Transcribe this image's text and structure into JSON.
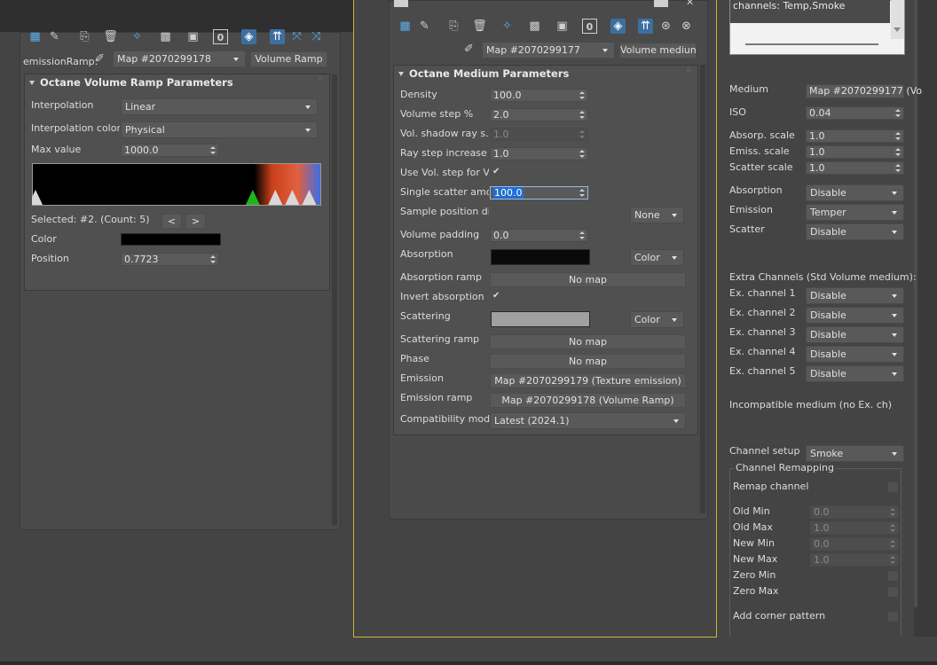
{
  "colors": {
    "background": "#444444",
    "panel": "#505050",
    "accent_yellow": "#c8b438",
    "selection_blue": "#1e6ed0"
  },
  "left_window": {
    "toolbar_icons": [
      "checker-icon",
      "brush-icon",
      "gap",
      "paste-icon",
      "trash-icon",
      "sparkle-icon",
      "checker-icon",
      "cube-icon",
      "zero-icon",
      "pin-icon",
      "tools-icon",
      "magnet-icon"
    ],
    "picker_label": "emissionRamp:",
    "map_select": "Map #2070299178",
    "type_button": "Volume Ramp",
    "rollout_title": "Octane Volume Ramp Parameters",
    "rows": [
      {
        "label": "Interpolation",
        "value": "Linear"
      },
      {
        "label": "Interpolation color...",
        "value": "Physical"
      }
    ],
    "max_value_label": "Max value",
    "max_value": "1000.0",
    "selected_text": "Selected: #2. (Count: 5)",
    "prev_button": "<",
    "next_button": ">",
    "color_label": "Color",
    "color_value": "#000000",
    "position_label": "Position",
    "position_value": "0.7723",
    "ramp_markers": [
      {
        "position": 0.0,
        "color": "#d8d8d8"
      },
      {
        "position": 0.77,
        "color": "#1fb51f"
      },
      {
        "position": 0.85,
        "color": "#d8d8d8"
      },
      {
        "position": 0.91,
        "color": "#d8d8d8"
      },
      {
        "position": 0.97,
        "color": "#d8d8d8"
      }
    ]
  },
  "mid_window": {
    "toolbar_icons": [
      "checker-icon",
      "brush-icon",
      "gap",
      "copy-icon",
      "trash-icon",
      "sparkle-icon",
      "checker-icon",
      "save-icon",
      "zero-icon",
      "cube-icon",
      "pin-icon",
      "zoom-icon",
      "zoom2-icon"
    ],
    "map_select": "Map #2070299177",
    "type_button": "Volume medium",
    "rollout_title": "Octane Medium Parameters",
    "density_label": "Density",
    "density_value": "100.0",
    "volume_step_label": "Volume step %",
    "volume_step_value": "2.0",
    "vol_shadow_label": "Vol. shadow ray s...",
    "vol_shadow_value": "1.0",
    "ray_step_label": "Ray step increase ...",
    "ray_step_value": "1.0",
    "use_vol_step_label": "Use Vol. step for V...",
    "single_scatter_label": "Single scatter amo...",
    "single_scatter_value": "100.0",
    "sample_pos_label": "Sample position dis...",
    "sample_pos_value": "None",
    "volume_padding_label": "Volume padding",
    "volume_padding_value": "0.0",
    "absorption_label": "Absorption",
    "absorption_color": "#0a0a0a",
    "absorption_mode": "Color",
    "absorption_ramp_label": "Absorption ramp",
    "absorption_ramp_value": "No map",
    "invert_absorption_label": "Invert absorption",
    "scattering_label": "Scattering",
    "scattering_color": "#a0a0a0",
    "scattering_mode": "Color",
    "scattering_ramp_label": "Scattering ramp",
    "scattering_ramp_value": "No map",
    "phase_label": "Phase",
    "phase_value": "No map",
    "emission_label": "Emission",
    "emission_value": "Map #2070299179 (Texture emission)",
    "emission_ramp_label": "Emission ramp",
    "emission_ramp_value": "Map #2070299178 (Volume Ramp)",
    "compat_label": "Compatibility mode",
    "compat_value": "Latest (2024.1)"
  },
  "right_panel": {
    "channels_text": "channels: Temp,Smoke",
    "medium_label": "Medium",
    "medium_value": "Map #2070299177 (Vo",
    "iso_label": "ISO",
    "iso_value": "0.04",
    "absorp_scale_label": "Absorp. scale",
    "absorp_scale_value": "1.0",
    "emiss_scale_label": "Emiss. scale",
    "emiss_scale_value": "1.0",
    "scatter_scale_label": "Scatter scale",
    "scatter_scale_value": "1.0",
    "absorption_label": "Absorption",
    "absorption_value": "Disable",
    "emission_label": "Emission",
    "emission_value": "Temper",
    "scatter_label": "Scatter",
    "scatter_value": "Disable",
    "extra_title": "Extra Channels (Std Volume medium):",
    "extra_channels": [
      {
        "label": "Ex. channel 1",
        "value": "Disable"
      },
      {
        "label": "Ex. channel 2",
        "value": "Disable"
      },
      {
        "label": "Ex. channel 3",
        "value": "Disable"
      },
      {
        "label": "Ex. channel 4",
        "value": "Disable"
      },
      {
        "label": "Ex. channel 5",
        "value": "Disable"
      }
    ],
    "incompatible_text": "Incompatible medium (no Ex. ch)",
    "channel_setup_label": "Channel setup",
    "channel_setup_value": "Smoke",
    "remap_group_title": "Channel Remapping",
    "remap_channel_label": "Remap channel",
    "old_min_label": "Old Min",
    "old_min_value": "0.0",
    "old_max_label": "Old Max",
    "old_max_value": "1.0",
    "new_min_label": "New Min",
    "new_min_value": "0.0",
    "new_max_label": "New Max",
    "new_max_value": "1.0",
    "zero_min_label": "Zero Min",
    "zero_max_label": "Zero Max",
    "corner_label": "Add corner pattern"
  }
}
